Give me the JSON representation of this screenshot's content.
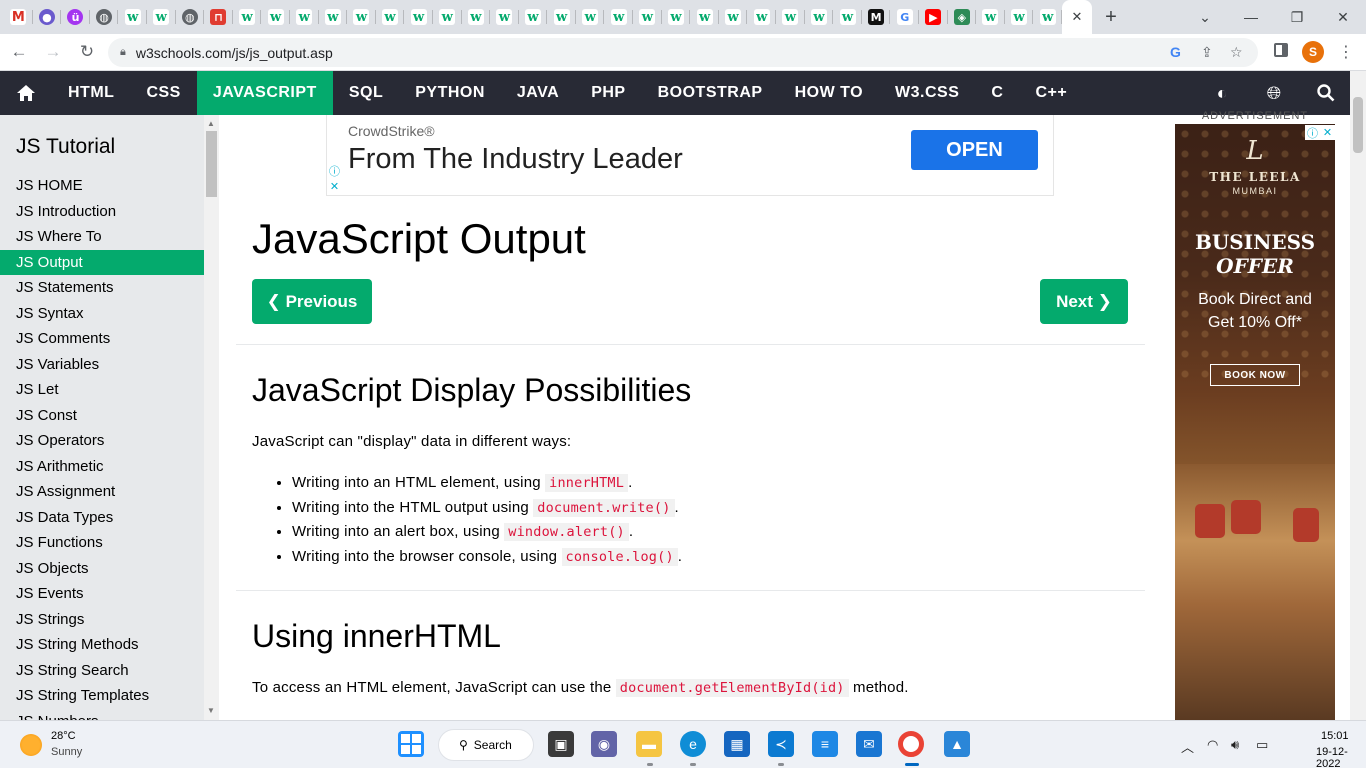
{
  "browser": {
    "tabs": [
      {
        "icon": "gmail-icon",
        "glyph": "M"
      },
      {
        "icon": "profile-icon",
        "glyph": "●"
      },
      {
        "icon": "udemy-icon",
        "glyph": "ü"
      },
      {
        "icon": "globe-icon",
        "glyph": "◍"
      },
      {
        "icon": "w3schools-icon",
        "glyph": "w"
      },
      {
        "icon": "w3schools-icon",
        "glyph": "w"
      },
      {
        "icon": "globe-icon",
        "glyph": "◍"
      },
      {
        "icon": "notion-red-icon",
        "glyph": "⊓"
      },
      {
        "icon": "w3schools-icon",
        "glyph": "w"
      },
      {
        "icon": "w3schools-icon",
        "glyph": "w"
      },
      {
        "icon": "w3schools-icon",
        "glyph": "w"
      },
      {
        "icon": "w3schools-icon",
        "glyph": "w"
      },
      {
        "icon": "w3schools-icon",
        "glyph": "w"
      },
      {
        "icon": "w3schools-icon",
        "glyph": "w"
      },
      {
        "icon": "w3schools-icon",
        "glyph": "w"
      },
      {
        "icon": "w3schools-icon",
        "glyph": "w"
      },
      {
        "icon": "w3schools-icon",
        "glyph": "w"
      },
      {
        "icon": "w3schools-icon",
        "glyph": "w"
      },
      {
        "icon": "w3schools-icon",
        "glyph": "w"
      },
      {
        "icon": "w3schools-icon",
        "glyph": "w"
      },
      {
        "icon": "w3schools-icon",
        "glyph": "w"
      },
      {
        "icon": "w3schools-icon",
        "glyph": "w"
      },
      {
        "icon": "w3schools-icon",
        "glyph": "w"
      },
      {
        "icon": "w3schools-icon",
        "glyph": "w"
      },
      {
        "icon": "w3schools-icon",
        "glyph": "w"
      },
      {
        "icon": "w3schools-icon",
        "glyph": "w"
      },
      {
        "icon": "w3schools-icon",
        "glyph": "w"
      },
      {
        "icon": "w3schools-icon",
        "glyph": "w"
      },
      {
        "icon": "w3schools-icon",
        "glyph": "w"
      },
      {
        "icon": "w3schools-icon",
        "glyph": "w"
      },
      {
        "icon": "medium-icon",
        "glyph": "M"
      },
      {
        "icon": "google-icon",
        "glyph": "G"
      },
      {
        "icon": "youtube-icon",
        "glyph": "▶"
      },
      {
        "icon": "layers-icon",
        "glyph": "◈"
      },
      {
        "icon": "w3schools-icon",
        "glyph": "w"
      },
      {
        "icon": "w3schools-icon",
        "glyph": "w"
      },
      {
        "icon": "w3schools-icon",
        "glyph": "w"
      }
    ],
    "active_tab_close": "✕",
    "new_tab": "+",
    "url": "w3schools.com/js/js_output.asp",
    "profile_initial": "S"
  },
  "topnav": {
    "items": [
      "HTML",
      "CSS",
      "JAVASCRIPT",
      "SQL",
      "PYTHON",
      "JAVA",
      "PHP",
      "BOOTSTRAP",
      "HOW TO",
      "W3.CSS",
      "C",
      "C++"
    ],
    "active_index": 2
  },
  "sidebar": {
    "title": "JS Tutorial",
    "items": [
      "JS HOME",
      "JS Introduction",
      "JS Where To",
      "JS Output",
      "JS Statements",
      "JS Syntax",
      "JS Comments",
      "JS Variables",
      "JS Let",
      "JS Const",
      "JS Operators",
      "JS Arithmetic",
      "JS Assignment",
      "JS Data Types",
      "JS Functions",
      "JS Objects",
      "JS Events",
      "JS Strings",
      "JS String Methods",
      "JS String Search",
      "JS String Templates",
      "JS Numbers"
    ],
    "active_index": 3
  },
  "ad_top": {
    "brand": "CrowdStrike®",
    "headline": "From The Industry Leader",
    "cta": "OPEN"
  },
  "main": {
    "title": "JavaScript Output",
    "prev_label": "❮ Previous",
    "next_label": "Next ❯",
    "section1_heading": "JavaScript Display Possibilities",
    "section1_intro": "JavaScript can \"display\" data in different ways:",
    "list": [
      {
        "text": "Writing into an HTML element, using ",
        "code": "innerHTML",
        "after": "."
      },
      {
        "text": "Writing into the HTML output using ",
        "code": "document.write()",
        "after": "."
      },
      {
        "text": "Writing into an alert box, using ",
        "code": "window.alert()",
        "after": "."
      },
      {
        "text": "Writing into the browser console, using ",
        "code": "console.log()",
        "after": "."
      }
    ],
    "section2_heading": "Using innerHTML",
    "section2_text_before": "To access an HTML element, JavaScript can use the ",
    "section2_code": "document.getElementById(id)",
    "section2_text_after": " method."
  },
  "right_ad": {
    "label": "ADVERTISEMENT",
    "logo": "L",
    "hotel": "THE LEELA",
    "city": "MUMBAI",
    "headline_1": "BUSINESS",
    "headline_2": "OFFER",
    "body_1": "Book Direct and",
    "body_2": "Get 10% Off*",
    "cta": "BOOK NOW"
  },
  "taskbar": {
    "temperature": "28°C",
    "condition": "Sunny",
    "search_label": "Search",
    "time": "15:01",
    "date": "19-12-2022"
  },
  "colors": {
    "w3_green": "#04aa6d",
    "w3_dark": "#282a35",
    "sidebar_bg": "#e7e9eb",
    "code_red": "#dc143c",
    "ad_blue": "#1a73e8"
  }
}
